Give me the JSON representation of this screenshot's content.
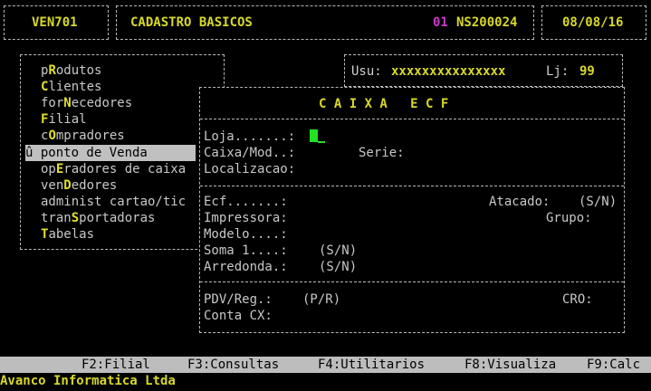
{
  "header": {
    "program_code": "VEN701",
    "screen_title": "CADASTRO BASICOS",
    "company_number": "01",
    "system_id": "NS200024",
    "date": "08/08/16"
  },
  "user_info": {
    "user_label": "Usu:",
    "user_value": "xxxxxxxxxxxxxxx",
    "store_label": "Lj:",
    "store_value": "99"
  },
  "menu": {
    "items": [
      {
        "pre": "p",
        "hot": "R",
        "post": "odutos"
      },
      {
        "pre": "",
        "hot": "C",
        "post": "lientes"
      },
      {
        "pre": "for",
        "hot": "N",
        "post": "ecedores"
      },
      {
        "pre": "",
        "hot": "F",
        "post": "ilial"
      },
      {
        "pre": "c",
        "hot": "O",
        "post": "mpradores"
      },
      {
        "pre": "û ponto de Venda",
        "hot": "",
        "post": ""
      },
      {
        "pre": "op",
        "hot": "E",
        "post": "radores de caixa"
      },
      {
        "pre": "ven",
        "hot": "D",
        "post": "edores"
      },
      {
        "pre": "administ cartao/tic",
        "hot": "",
        "post": ""
      },
      {
        "pre": "tran",
        "hot": "S",
        "post": "portadoras"
      },
      {
        "pre": "",
        "hot": "T",
        "post": "abelas"
      }
    ]
  },
  "dialog": {
    "title": "C A I X A   E C F",
    "loja_label": "Loja.......:",
    "caixa_label": "Caixa/Mod..:",
    "serie_label": "Serie:",
    "localizacao_label": "Localizacao:",
    "ecf_label": "Ecf.......:",
    "atacado_label": "Atacado:",
    "atacado_opt": "(S/N)",
    "impressora_label": "Impressora:",
    "grupo_label": "Grupo:",
    "modelo_label": "Modelo....:",
    "soma_label": "Soma 1....:",
    "soma_opt": "(S/N)",
    "arredonda_label": "Arredonda.:",
    "arredonda_opt": "(S/N)",
    "pdv_label": "PDV/Reg.:",
    "pdv_opt": "(P/R)",
    "cro_label": "CRO:",
    "conta_label": "Conta CX:"
  },
  "function_keys": {
    "f2": "F2:Filial",
    "f3": "F3:Consultas",
    "f4": "F4:Utilitarios",
    "f8": "F8:Visualiza",
    "f9": "F9:Calc"
  },
  "footer": {
    "company": "Avanco Informatica Ltda"
  },
  "colors": {
    "background": "#000000",
    "highlight": "#d8d82a",
    "accent": "#c83ac8",
    "cursor": "#22e022",
    "bar": "#bdbdbd"
  }
}
